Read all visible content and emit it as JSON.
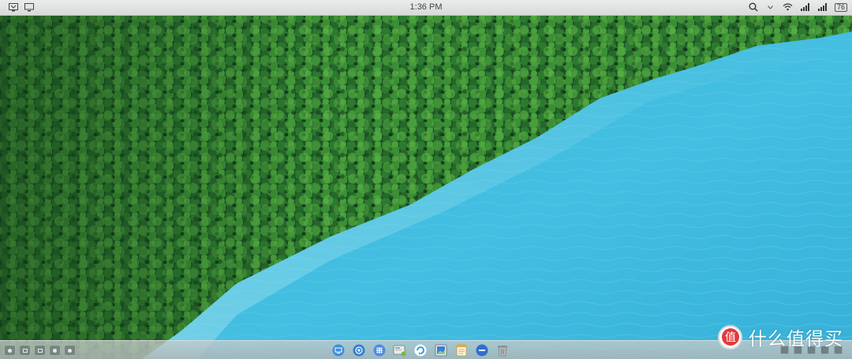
{
  "status_bar": {
    "time": "1:36 PM",
    "battery": "76",
    "left_icons": [
      "screenshot-icon",
      "monitor-icon"
    ],
    "right_icons": [
      "search-icon",
      "dropdown-arrow-icon",
      "wifi-icon",
      "signal-icon",
      "signal-icon",
      "battery-icon"
    ]
  },
  "dock": {
    "items": [
      {
        "name": "dock-item-monitor",
        "icon": "monitor-icon",
        "color": "#3d8ee0"
      },
      {
        "name": "dock-item-browser",
        "icon": "browser-icon",
        "color": "#2f7fd8"
      },
      {
        "name": "dock-item-launcher",
        "icon": "grid-icon",
        "color": "#4a8be8"
      },
      {
        "name": "dock-item-screen-capture",
        "icon": "screen-capture-icon",
        "color": "#6fbf3a"
      },
      {
        "name": "dock-item-sync",
        "icon": "sync-icon",
        "color": "#2a9ee0"
      },
      {
        "name": "dock-item-image-viewer",
        "icon": "image-icon",
        "color": "#3c7ecf"
      },
      {
        "name": "dock-item-notes",
        "icon": "notes-icon",
        "color": "#e8a93a"
      },
      {
        "name": "dock-item-minus",
        "icon": "minus-circle-icon",
        "color": "#2f6fd0"
      },
      {
        "name": "dock-item-trash",
        "icon": "trash-icon",
        "color": "#9aa0a0"
      }
    ]
  },
  "bottom_left_buttons": [
    "settings-icon",
    "window-icon",
    "desktop-icon",
    "toggle-icon",
    "record-icon"
  ],
  "watermark": {
    "text": "什么值得买",
    "logo_glyph": "值"
  },
  "colors": {
    "forest": "#1f5a28",
    "water": "#3bb8dc",
    "status_bar": "#e3e6e4"
  }
}
